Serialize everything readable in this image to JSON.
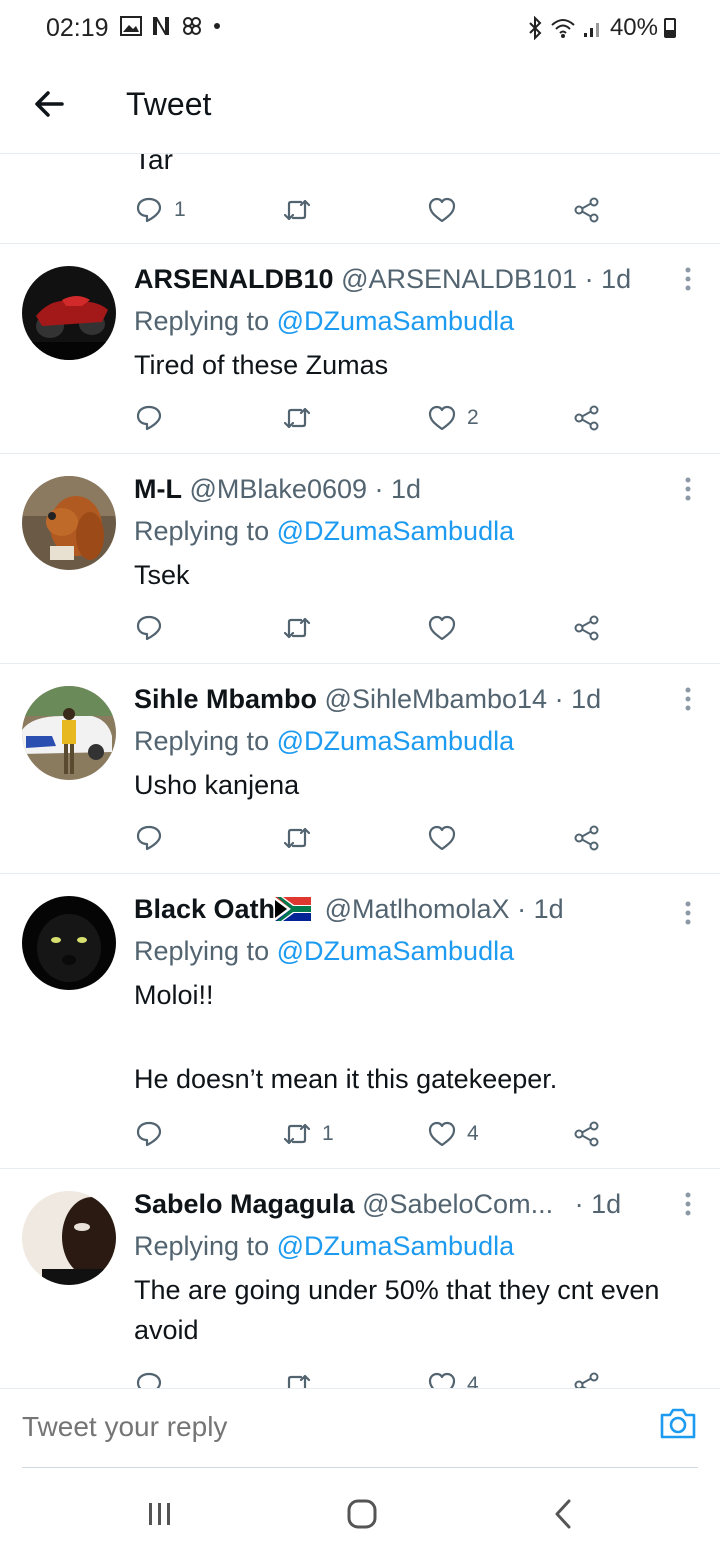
{
  "status": {
    "time": "02:19",
    "battery": "40%"
  },
  "header": {
    "title": "Tweet"
  },
  "top_partial": {
    "text": "Tar",
    "reply_count": "1"
  },
  "tweets": [
    {
      "name": "ARSENALDB10",
      "handle": "@ARSENALDB101",
      "time": "· 1d",
      "replying_prefix": "Replying to ",
      "replying_to": "@DZumaSambudla",
      "text": "Tired of these Zumas",
      "reply_count": "",
      "retweet_count": "",
      "like_count": "2"
    },
    {
      "name": "M-L",
      "handle": "@MBlake0609",
      "time": "· 1d",
      "replying_prefix": "Replying to ",
      "replying_to": "@DZumaSambudla",
      "text": "Tsek",
      "reply_count": "",
      "retweet_count": "",
      "like_count": ""
    },
    {
      "name": "Sihle Mbambo",
      "handle": "@SihleMbambo14",
      "time": "· 1d",
      "replying_prefix": "Replying to ",
      "replying_to": "@DZumaSambudla",
      "text": "Usho kanjena",
      "reply_count": "",
      "retweet_count": "",
      "like_count": ""
    },
    {
      "name": "Black Oath",
      "handle": "@MatlhomolaX",
      "time": "· 1d",
      "replying_prefix": "Replying to ",
      "replying_to": "@DZumaSambudla",
      "text": "Moloi!!",
      "text2": "He doesn’t mean it this gatekeeper.",
      "reply_count": "",
      "retweet_count": "1",
      "like_count": "4"
    },
    {
      "name": "Sabelo Magagula",
      "handle": "@SabeloCom...",
      "time": "· 1d",
      "replying_prefix": "Replying to ",
      "replying_to": "@DZumaSambudla",
      "text": "The are going under 50% that they cnt even avoid",
      "reply_count": "",
      "retweet_count": "",
      "like_count": "4"
    }
  ],
  "reply_bar": {
    "placeholder": "Tweet your reply"
  },
  "colors": {
    "link": "#1d9bf0",
    "secondary": "#536471",
    "divider": "#e6ecf0"
  }
}
